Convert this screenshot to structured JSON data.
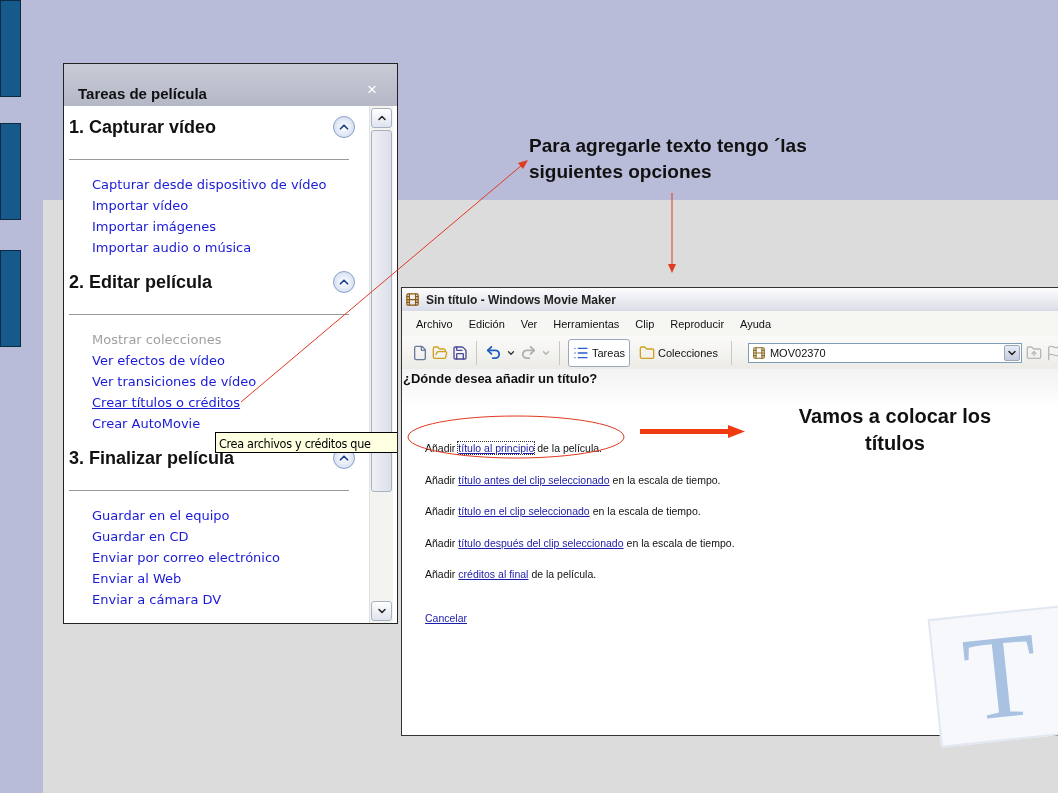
{
  "task_pane": {
    "title": "Tareas de película",
    "close": "×",
    "sections": [
      {
        "title": "1. Capturar vídeo",
        "expanded": true,
        "links": [
          {
            "label": "Capturar desde dispositivo de vídeo",
            "disabled": false,
            "hovered": false
          },
          {
            "label": "Importar vídeo",
            "disabled": false,
            "hovered": false
          },
          {
            "label": "Importar imágenes",
            "disabled": false,
            "hovered": false
          },
          {
            "label": "Importar audio o música",
            "disabled": false,
            "hovered": false
          }
        ]
      },
      {
        "title": "2. Editar película",
        "expanded": true,
        "links": [
          {
            "label": "Mostrar colecciones",
            "disabled": true,
            "hovered": false
          },
          {
            "label": "Ver efectos de vídeo",
            "disabled": false,
            "hovered": false
          },
          {
            "label": "Ver transiciones de vídeo",
            "disabled": false,
            "hovered": false
          },
          {
            "label": "Crear títulos o créditos",
            "disabled": false,
            "hovered": true
          },
          {
            "label": "Crear AutoMovie",
            "disabled": false,
            "hovered": false
          }
        ]
      },
      {
        "title": "3. Finalizar película",
        "expanded": true,
        "links": [
          {
            "label": "Guardar en el equipo",
            "disabled": false,
            "hovered": false
          },
          {
            "label": "Guardar en CD",
            "disabled": false,
            "hovered": false
          },
          {
            "label": "Enviar por correo electrónico",
            "disabled": false,
            "hovered": false
          },
          {
            "label": "Enviar al Web",
            "disabled": false,
            "hovered": false
          },
          {
            "label": "Enviar a cámara DV",
            "disabled": false,
            "hovered": false
          }
        ]
      }
    ],
    "tooltip": "Crea archivos y créditos que"
  },
  "callouts": [
    "Para agregarle texto tengo ´las siguientes opciones",
    "Vamos a colocar los títulos"
  ],
  "window": {
    "title": "Sin título - Windows Movie Maker",
    "menu": [
      "Archivo",
      "Edición",
      "Ver",
      "Herramientas",
      "Clip",
      "Reproducir",
      "Ayuda"
    ],
    "toolbar": {
      "buttons": [
        {
          "label": "Tareas",
          "selected": true
        },
        {
          "label": "Colecciones",
          "selected": false
        }
      ],
      "collection": "MOV02370"
    },
    "heading": "¿Dónde desea añadir un título?",
    "options": [
      {
        "prefix": "Añadir",
        "link": "título al principio",
        "suffix": "de la película.",
        "focused": true
      },
      {
        "prefix": "Añadir",
        "link": "título antes del clip seleccionado",
        "suffix": "en la escala de tiempo.",
        "focused": false
      },
      {
        "prefix": "Añadir",
        "link": "título en el clip seleccionado",
        "suffix": "en la escala de tiempo.",
        "focused": false
      },
      {
        "prefix": "Añadir",
        "link": "título después del clip seleccionado",
        "suffix": "en la escala de tiempo.",
        "focused": false
      },
      {
        "prefix": "Añadir",
        "link": "créditos al final",
        "suffix": "de la película.",
        "focused": false
      }
    ],
    "cancel": "Cancelar",
    "emblem": "T"
  }
}
